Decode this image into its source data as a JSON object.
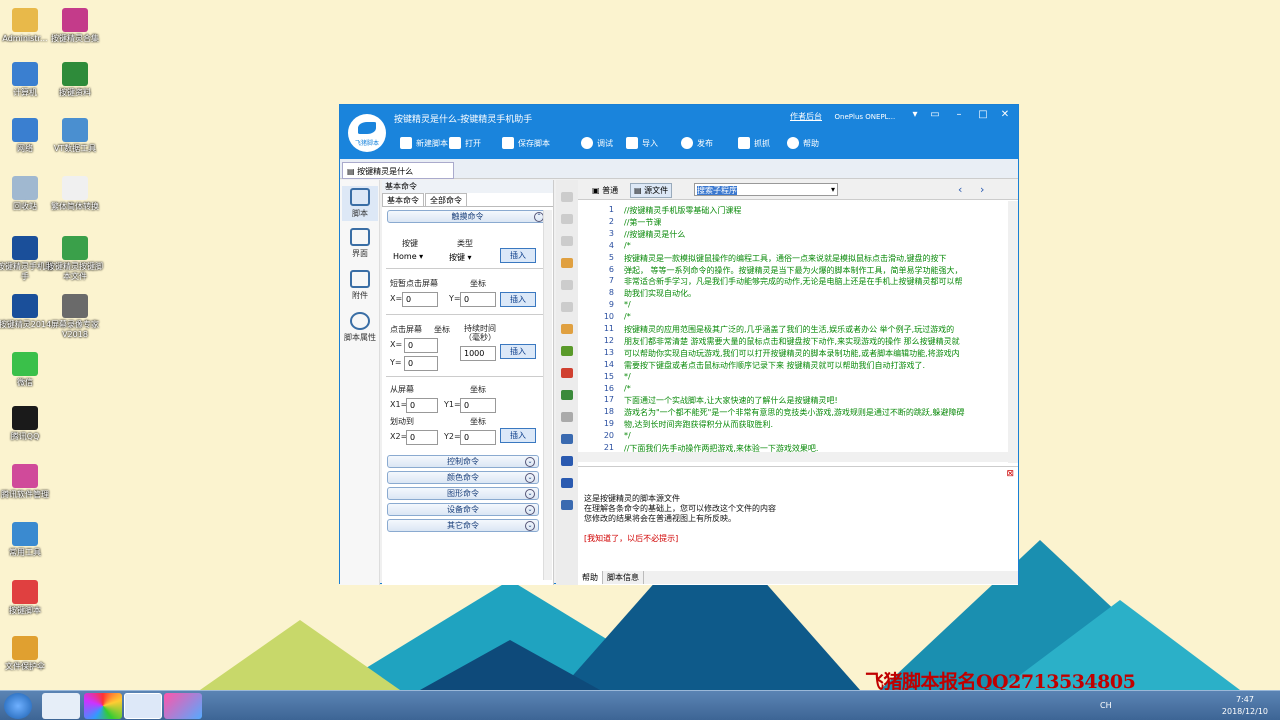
{
  "desktop": {
    "icons": [
      {
        "label": "Administr...",
        "color": "#e8b94a"
      },
      {
        "label": "按键精灵合集",
        "color": "#c43b8a"
      },
      {
        "label": "计算机",
        "color": "#3a7fd0"
      },
      {
        "label": "按键资料",
        "color": "#2e8b3a"
      },
      {
        "label": "网络",
        "color": "#3a7fd0"
      },
      {
        "label": "VT数据工具",
        "color": "#4a8fd0"
      },
      {
        "label": "回收站",
        "color": "#a0b8d0"
      },
      {
        "label": "繁体简体转换",
        "color": "#f0f0f0"
      },
      {
        "label": "按键精灵手机助手",
        "color": "#1a4f9a"
      },
      {
        "label": "按键精灵按键脚本文件",
        "color": "#3aa04a"
      },
      {
        "label": "按键精灵2014",
        "color": "#1a4f9a"
      },
      {
        "label": "屏幕录像专家V2018",
        "color": "#6a6a6a"
      },
      {
        "label": "微信",
        "color": "#3ac04a"
      },
      {
        "label": "腾讯QQ",
        "color": "#1a1a1a"
      },
      {
        "label": "腾讯软件管理",
        "color": "#d04a9a"
      },
      {
        "label": "常用工具",
        "color": "#3a8ad0"
      },
      {
        "label": "按键脚本",
        "color": "#e04040"
      },
      {
        "label": "文件保护伞",
        "color": "#e0a030"
      }
    ]
  },
  "watermark": "飞猪脚本报名QQ2713534805",
  "window": {
    "title": "按键精灵是什么-按键精灵手机助手",
    "logo_text": "飞猪脚本",
    "author_link": "作者后台",
    "device": "OnePlus  ONEPL...",
    "toolbar": [
      "新建脚本",
      "打开",
      "保存脚本",
      "调试",
      "导入",
      "发布",
      "抓抓",
      "帮助"
    ],
    "doc_tab": "按键精灵是什么",
    "nav": [
      "脚本",
      "界面",
      "附件",
      "脚本属性"
    ],
    "panel": {
      "header": "基本命令",
      "tabs": [
        "基本命令",
        "全部命令"
      ],
      "categories_top": "触摸命令",
      "key_label": "按键",
      "type_label": "类型",
      "key_value": "Home",
      "type_value": "按键",
      "insert": "插入",
      "tap_label": "短暂点击屏幕",
      "coord_label": "坐标",
      "x_label": "X=",
      "y_label": "Y=",
      "x_val": "0",
      "y_val": "0",
      "tap2_label": "点击屏幕",
      "coord2_label": "坐标",
      "duration_label": "持续时间（毫秒）",
      "duration_val": "1000",
      "swipe_from": "从屏幕",
      "swipe_to": "划动到",
      "x1": "X1=",
      "y1": "Y1=",
      "x2": "X2=",
      "y2": "Y2=",
      "categories_bottom": [
        "控制命令",
        "颜色命令",
        "图形命令",
        "设备命令",
        "其它命令"
      ]
    },
    "editor": {
      "mode_normal": "普通",
      "mode_source": "源文件",
      "search": "搜索子程序",
      "lines": [
        {
          "n": "1",
          "t": "//按键精灵手机版零基础入门课程"
        },
        {
          "n": "2",
          "t": "//第一节课"
        },
        {
          "n": "3",
          "t": "//按键精灵是什么"
        },
        {
          "n": "4",
          "t": "/*"
        },
        {
          "n": "5",
          "t": "按键精灵是一款模拟键鼠操作的编程工具，通俗一点来说就是模拟鼠标点击滑动,键盘的按下"
        },
        {
          "n": "6",
          "t": "弹起，  等等一系列命令的操作。按键精灵是当下最为火爆的脚本制作工具，简单易学功能强大，"
        },
        {
          "n": "7",
          "t": "非常适合新手学习，凡是我们手动能够完成的动作,无论是电脑上还是在手机上按键精灵都可以帮"
        },
        {
          "n": "8",
          "t": "助我们实现自动化。"
        },
        {
          "n": "9",
          "t": "*/"
        },
        {
          "n": "10",
          "t": "/*"
        },
        {
          "n": "11",
          "t": "按键精灵的应用范围是极其广泛的,几乎涵盖了我们的生活,娱乐或者办公 举个例子,玩过游戏的"
        },
        {
          "n": "12",
          "t": "朋友们都非常清楚 游戏需要大量的鼠标点击和键盘按下动作,来实现游戏的操作 那么按键精灵就"
        },
        {
          "n": "13",
          "t": "可以帮助你实现自动玩游戏,我们可以打开按键精灵的脚本录制功能,或者脚本编辑功能,将游戏内"
        },
        {
          "n": "14",
          "t": "需要按下键盘或者点击鼠标动作顺序记录下来 按键精灵就可以帮助我们自动打游戏了."
        },
        {
          "n": "15",
          "t": "*/"
        },
        {
          "n": "16",
          "t": "/*"
        },
        {
          "n": "17",
          "t": "下面通过一个实战脚本,让大家快速的了解什么是按键精灵吧!"
        },
        {
          "n": "18",
          "t": "游戏名为\"一个都不能死\"是一个非常有意思的竞技类小游戏,游戏规则是通过不断的跳跃,躲避障碍"
        },
        {
          "n": "19",
          "t": "物,达到长时间奔跑获得积分从而获取胜利."
        },
        {
          "n": "20",
          "t": "*/"
        },
        {
          "n": "21",
          "t": "//下面我们先手动操作两把游戏,来体验一下游戏效果吧."
        }
      ],
      "help_lines": [
        "这是按键精灵的脚本源文件",
        "在理解各条命令的基础上，您可以修改这个文件的内容",
        "您修改的结果将会在普通视图上有所反映。"
      ],
      "help_red": "[我知道了，以后不必提示]",
      "bottom_tabs": [
        "帮助",
        "脚本信息"
      ]
    }
  },
  "taskbar": {
    "tray": "CH",
    "time": "7:47",
    "date": "2018/12/10"
  }
}
